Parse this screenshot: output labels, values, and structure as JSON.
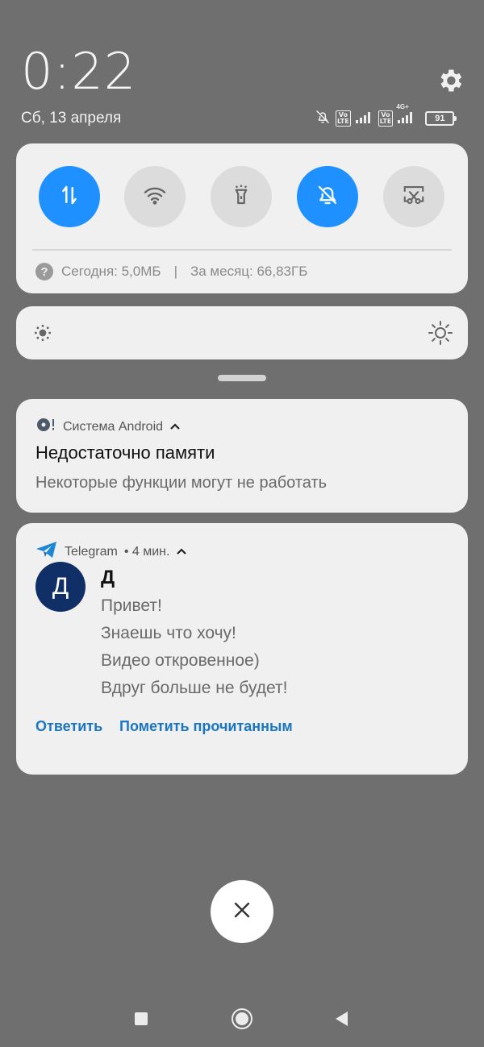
{
  "status_bar": {
    "time": "0:22",
    "date": "Сб, 13 апреля",
    "battery": "91",
    "volte_label": "Vo LTE",
    "network_label": "4G+"
  },
  "quick_settings": {
    "toggles": [
      {
        "name": "mobile-data",
        "icon": "data-transfer-icon",
        "state": "on"
      },
      {
        "name": "wifi",
        "icon": "wifi-icon",
        "state": "off"
      },
      {
        "name": "flashlight",
        "icon": "flashlight-icon",
        "state": "off"
      },
      {
        "name": "silent",
        "icon": "bell-off-icon",
        "state": "on"
      },
      {
        "name": "screenshot",
        "icon": "scissors-screenshot-icon",
        "state": "off"
      }
    ],
    "usage_today": "Сегодня: 5,0МБ",
    "separator": "|",
    "usage_month": "За месяц: 66,83ГБ"
  },
  "notifications": {
    "android": {
      "app": "Система Android",
      "title": "Недостаточно памяти",
      "text": "Некоторые функции могут не работать"
    },
    "telegram": {
      "app": "Telegram",
      "time": "• 4 мин.",
      "avatar_letter": "Д",
      "sender": "Д",
      "messages": [
        "Привет!",
        "Знаешь что хочу!",
        "Видео откровенное)",
        "Вдруг больше не будет!"
      ],
      "reply_label": "Ответить",
      "mark_read_label": "Пометить прочитанным"
    }
  },
  "colors": {
    "background": "#6f6f6f",
    "accent_on": "#1e90ff",
    "action_link": "#1976c5",
    "avatar": "#0f2f66"
  }
}
